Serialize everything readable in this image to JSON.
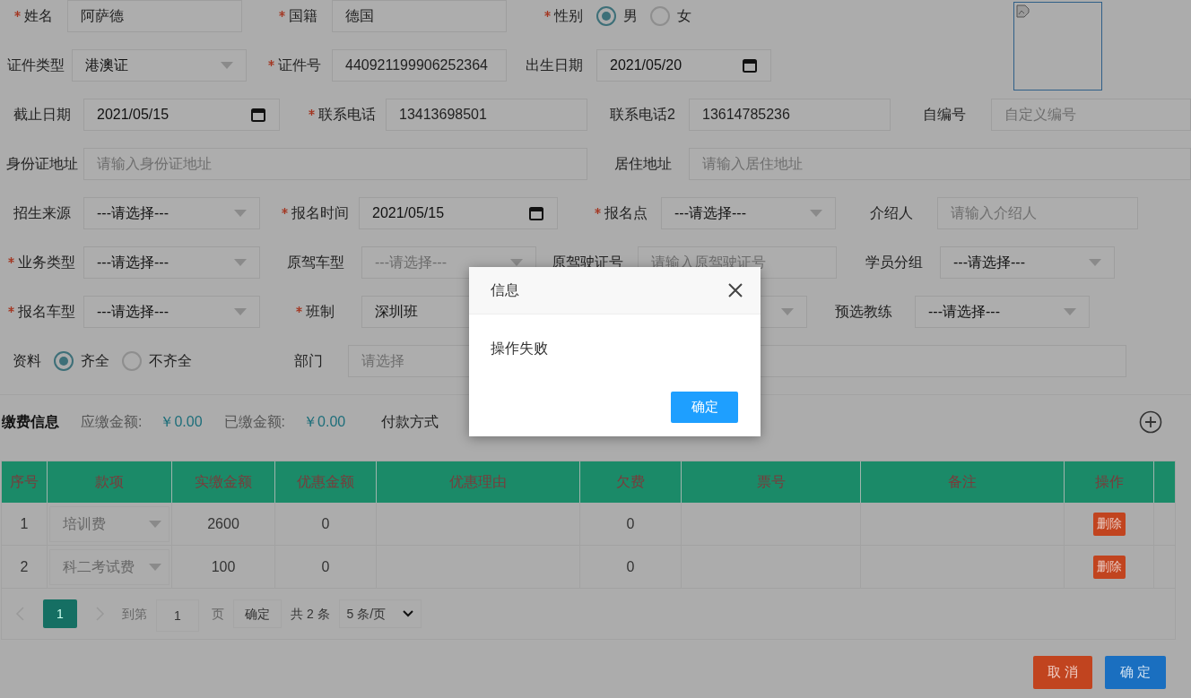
{
  "form": {
    "rows": [
      {
        "fields": [
          {
            "label": "姓名",
            "required": true,
            "kind": "input",
            "value": "阿萨德"
          },
          {
            "label": "国籍",
            "required": true,
            "kind": "input",
            "value": "德国"
          },
          {
            "label": "性别",
            "required": true,
            "kind": "radio",
            "options": [
              {
                "label": "男",
                "selected": true
              },
              {
                "label": "女",
                "selected": false
              }
            ]
          }
        ]
      },
      {
        "fields": [
          {
            "label": "证件类型",
            "required": false,
            "kind": "select",
            "value": "港澳证"
          },
          {
            "label": "证件号",
            "required": true,
            "kind": "input",
            "value": "440921199906252364"
          },
          {
            "label": "出生日期",
            "required": false,
            "kind": "date",
            "value": "2021/05/20"
          }
        ]
      },
      {
        "fields": [
          {
            "label": "截止日期",
            "required": false,
            "kind": "date",
            "value": "2021/05/15"
          },
          {
            "label": "联系电话",
            "required": true,
            "kind": "input",
            "value": "13413698501"
          },
          {
            "label": "联系电话2",
            "required": false,
            "kind": "input",
            "value": "13614785236"
          },
          {
            "label": "自编号",
            "required": false,
            "kind": "input",
            "placeholder": "自定义编号"
          }
        ]
      },
      {
        "fields": [
          {
            "label": "身份证地址",
            "required": false,
            "kind": "input",
            "placeholder": "请输入身份证地址"
          },
          {
            "label": "居住地址",
            "required": false,
            "kind": "input",
            "placeholder": "请输入居住地址"
          }
        ]
      },
      {
        "fields": [
          {
            "label": "招生来源",
            "required": false,
            "kind": "select",
            "value": "---请选择---"
          },
          {
            "label": "报名时间",
            "required": true,
            "kind": "date",
            "value": "2021/05/15"
          },
          {
            "label": "报名点",
            "required": true,
            "kind": "select",
            "value": "---请选择---"
          },
          {
            "label": "介绍人",
            "required": false,
            "kind": "input",
            "placeholder": "请输入介绍人"
          }
        ]
      },
      {
        "fields": [
          {
            "label": "业务类型",
            "required": true,
            "kind": "select",
            "value": "---请选择---"
          },
          {
            "label": "原驾车型",
            "required": false,
            "kind": "select",
            "value": "---请选择---",
            "disabled": true
          },
          {
            "label": "原驾驶证号",
            "required": false,
            "kind": "input",
            "placeholder": "请输入原驾驶证号"
          },
          {
            "label": "学员分组",
            "required": false,
            "kind": "select",
            "value": "---请选择---"
          }
        ]
      },
      {
        "fields": [
          {
            "label": "报名车型",
            "required": true,
            "kind": "select",
            "value": "---请选择---"
          },
          {
            "label": "班制",
            "required": true,
            "kind": "select",
            "value": "深圳班"
          },
          {
            "label": "预选教练",
            "required": false,
            "kind": "select",
            "value": "---请选择---"
          }
        ]
      },
      {
        "fields": [
          {
            "label": "资料",
            "required": false,
            "kind": "radio",
            "options": [
              {
                "label": "齐全",
                "selected": true
              },
              {
                "label": "不齐全",
                "selected": false
              }
            ]
          },
          {
            "label": "部门",
            "required": false,
            "kind": "input",
            "placeholder": "请选择"
          }
        ]
      }
    ]
  },
  "payment": {
    "title": "缴费信息",
    "due_label": "应缴金额:",
    "due": "￥0.00",
    "paid_label": "已缴金额:",
    "paid": "￥0.00",
    "method_label": "付款方式"
  },
  "table": {
    "columns": [
      "序号",
      "款项",
      "实缴金额",
      "优惠金额",
      "优惠理由",
      "欠费",
      "票号",
      "备注",
      "操作"
    ],
    "rows": [
      {
        "index": "1",
        "item": "培训费",
        "paid": "2600",
        "discount": "0",
        "reason": "",
        "owed": "0",
        "ticket": "",
        "note": "",
        "action": "删除"
      },
      {
        "index": "2",
        "item": "科二考试费",
        "paid": "100",
        "discount": "0",
        "reason": "",
        "owed": "0",
        "ticket": "",
        "note": "",
        "action": "删除"
      }
    ]
  },
  "pagination": {
    "pages": [
      {
        "label": "1",
        "selected": true
      }
    ],
    "goto_label": "到第",
    "goto_value": "1",
    "page_label": "页",
    "confirm": "确定",
    "total": "共 2 条",
    "page_size": "5 条/页"
  },
  "buttons": {
    "cancel": "取 消",
    "ok": "确 定"
  },
  "dialog": {
    "title": "信息",
    "message": "操作失败",
    "button": "确定"
  }
}
